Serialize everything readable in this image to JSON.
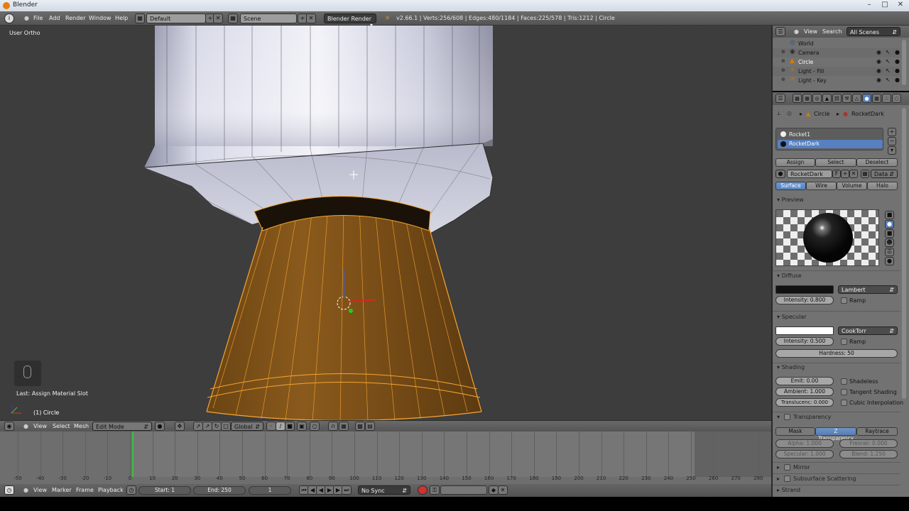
{
  "window": {
    "title": "Blender"
  },
  "topbar": {
    "menus": [
      "File",
      "Add",
      "Render",
      "Window",
      "Help"
    ],
    "screen_layout": "Default",
    "scene": "Scene",
    "render_engine": "Blender Render",
    "stats": "v2.66.1 | Verts:256/608 | Edges:480/1184 | Faces:225/578 | Tris:1212 | Circle"
  },
  "viewport": {
    "view_label": "User Ortho",
    "last_operator": "Last: Assign Material Slot",
    "object_label": "(1) Circle"
  },
  "view3d_header": {
    "menus": [
      "View",
      "Select",
      "Mesh"
    ],
    "mode": "Edit Mode",
    "orientation": "Global"
  },
  "timeline": {
    "ticks": [
      "-50",
      "-40",
      "-30",
      "-20",
      "-10",
      "0",
      "10",
      "20",
      "30",
      "40",
      "50",
      "60",
      "70",
      "80",
      "90",
      "100",
      "110",
      "120",
      "130",
      "140",
      "150",
      "160",
      "170",
      "180",
      "190",
      "200",
      "210",
      "220",
      "230",
      "240",
      "250",
      "260",
      "270",
      "280"
    ],
    "current_frame": 1
  },
  "timeline_footer": {
    "menus": [
      "View",
      "Marker",
      "Frame",
      "Playback"
    ],
    "start": "Start: 1",
    "end": "End: 250",
    "frame": "1",
    "sync": "No Sync"
  },
  "outliner": {
    "menus": [
      "View",
      "Search"
    ],
    "scene_filter": "All Scenes",
    "items": [
      {
        "label": "World",
        "type": "world"
      },
      {
        "label": "Camera",
        "type": "camera"
      },
      {
        "label": "Circle",
        "type": "mesh"
      },
      {
        "label": "Light - Fill",
        "type": "lamp"
      },
      {
        "label": "Light - Key",
        "type": "lamp"
      }
    ]
  },
  "properties": {
    "breadcrumb": [
      "Circle",
      "RocketDark"
    ],
    "material_slots": [
      "Rocket1",
      "RocketDark"
    ],
    "slot_buttons": [
      "Assign",
      "Select",
      "Deselect"
    ],
    "material_name": "RocketDark",
    "fake_user": "F",
    "data_dropdown": "Data",
    "tabs": [
      "Surface",
      "Wire",
      "Volume",
      "Halo"
    ],
    "preview_title": "Preview",
    "diffuse": {
      "title": "Diffuse",
      "shader": "Lambert",
      "intensity": "Intensity: 0.800",
      "ramp": "Ramp",
      "color": "#111111"
    },
    "specular": {
      "title": "Specular",
      "shader": "CookTorr",
      "intensity": "Intensity: 0.500",
      "ramp": "Ramp",
      "hardness": "Hardness: 50",
      "color": "#ffffff"
    },
    "shading": {
      "title": "Shading",
      "emit": "Emit: 0.00",
      "ambient": "Ambient: 1.000",
      "translucency": "Translucenc: 0.000",
      "shadeless": "Shadeless",
      "tangent": "Tangent Shading",
      "cubic": "Cubic Interpolation"
    },
    "transparency": {
      "title": "Transparency",
      "modes": [
        "Mask",
        "Z Transparency",
        "Raytrace"
      ],
      "alpha": "Alpha: 1.000",
      "fresnel": "Fresnel: 0.000",
      "specular": "Specular: 1.000",
      "blend": "Blend: 1.250"
    },
    "mirror": "Mirror",
    "sss": "Subsurface Scattering",
    "strand": "Strand"
  }
}
